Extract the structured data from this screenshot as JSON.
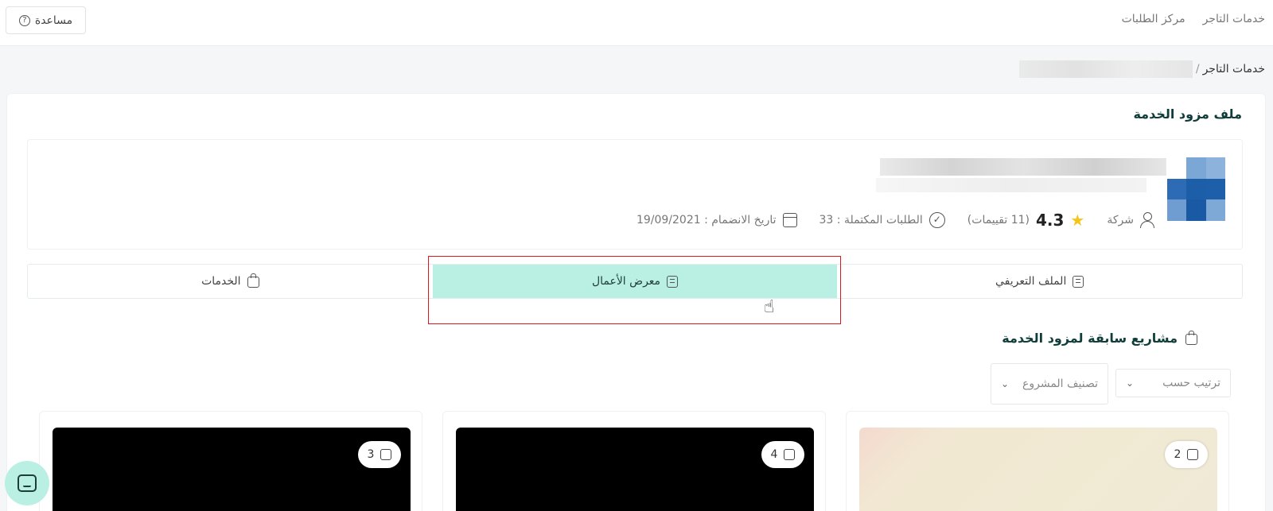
{
  "topbar": {
    "help_label": "مساعدة",
    "nav": [
      "خدمات التاجر",
      "مركز الطلبات"
    ]
  },
  "breadcrumb": {
    "root": "خدمات التاجر",
    "separator": "/"
  },
  "card": {
    "title": "ملف مزود الخدمة"
  },
  "profile": {
    "type": "شركة",
    "rating": "4.3",
    "ratings_count": "(11 تقييمات)",
    "completed_orders": "الطلبات المكتملة : 33",
    "join_date": "تاريخ الانضمام : 19/09/2021"
  },
  "tabs": [
    {
      "label": "الملف التعريفي",
      "active": false
    },
    {
      "label": "معرض الأعمال",
      "active": true
    },
    {
      "label": "الخدمات",
      "active": false
    }
  ],
  "section": {
    "title": "مشاريع سابقة لمزود الخدمة",
    "sort_placeholder": "ترتيب حسب",
    "category_placeholder": "تصنيف المشروع"
  },
  "projects": [
    {
      "count": "2"
    },
    {
      "count": "4"
    },
    {
      "count": "3"
    }
  ],
  "colors": {
    "accent": "#b9f0e3",
    "highlight": "#e0161e",
    "title": "#0f3d3a"
  }
}
